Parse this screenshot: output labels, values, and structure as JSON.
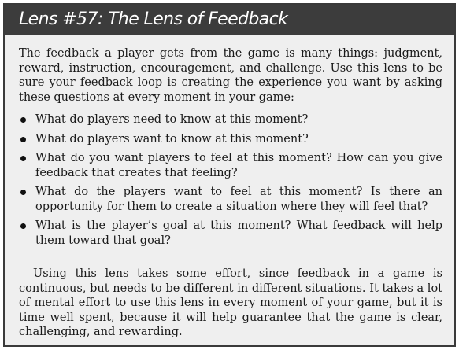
{
  "lens": {
    "title": "Lens #57: The Lens of Feedback",
    "intro": "The feedback a player gets from the game is many things: judgment, reward, instruction, encouragement, and challenge. Use this lens to be sure your feedback loop is creating the experience you want by asking these questions at every moment in your game:",
    "questions": [
      "What do players need to know at this moment?",
      "What do players want to know at this moment?",
      "What do you want players to feel at this moment? How can you give feedback that creates that feeling?",
      "What do the players want to feel at this moment? Is there an opportunity for them to create a situation where they will feel that?",
      "What is the player’s goal at this moment? What feedback will help them toward that goal?"
    ],
    "outro": "Using this lens takes some effort, since feedback in a game is continuous, but needs to be different in different situations. It takes a lot of mental effort to use this lens in every moment of your game, but it is time well spent, because it will help guarantee that the game is clear, challenging, and rewarding."
  },
  "colors": {
    "header_bg": "#3c3c3c",
    "box_bg": "#efefef",
    "title_text": "#ffffff",
    "body_text": "#1a1a1a"
  }
}
